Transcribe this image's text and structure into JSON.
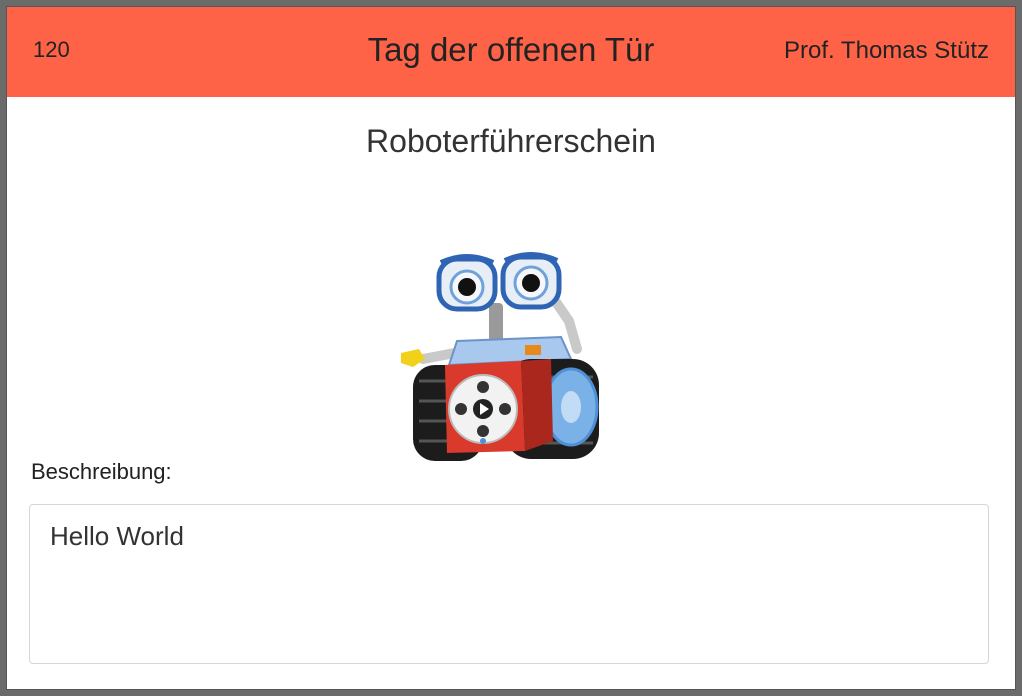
{
  "header": {
    "number": "120",
    "title": "Tag der offenen Tür",
    "author": "Prof. Thomas Stütz"
  },
  "station": {
    "name": "Roboterführerschein",
    "image_icon": "robot-icon"
  },
  "description": {
    "label": "Beschreibung:",
    "value": "Hello World"
  },
  "colors": {
    "header_bg": "#ff6347",
    "robot_red": "#d93a2b",
    "robot_blue": "#4f8fd6"
  }
}
